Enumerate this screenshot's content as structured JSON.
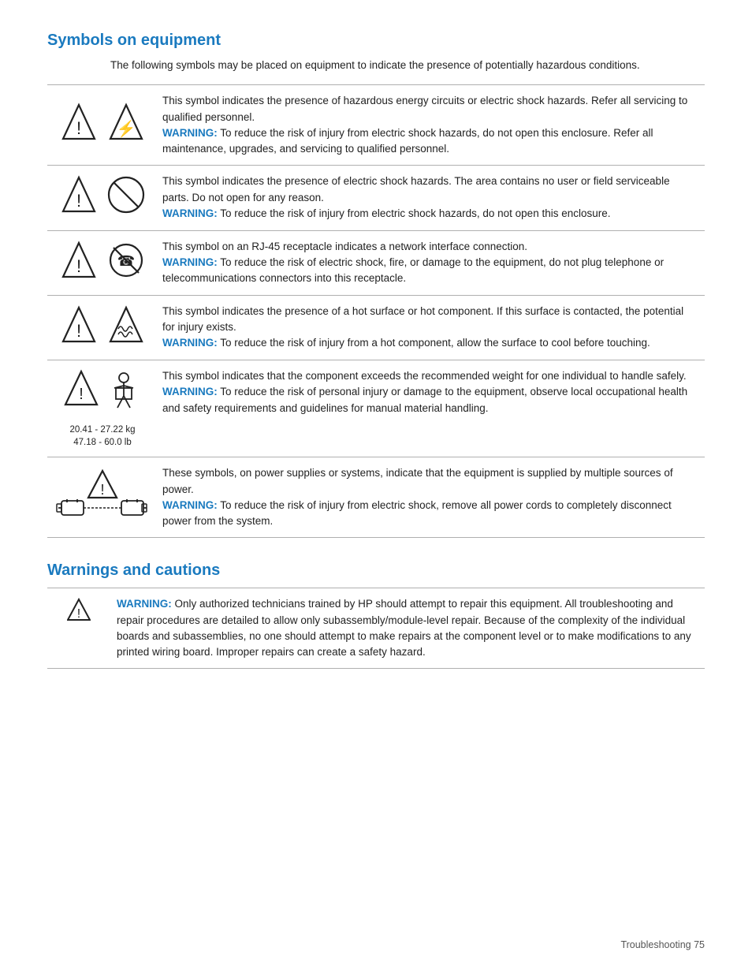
{
  "page": {
    "title": "Symbols on equipment",
    "title2": "Warnings and cautions",
    "intro": "The following symbols may be placed on equipment to indicate the presence of potentially hazardous conditions.",
    "footer": "Troubleshooting    75"
  },
  "symbols": [
    {
      "id": "symbol-1",
      "desc": "This symbol indicates the presence of hazardous energy circuits or electric shock hazards. Refer all servicing to qualified personnel.",
      "warning": "WARNING:",
      "warning_text": " To reduce the risk of injury from electric shock hazards, do not open this enclosure. Refer all maintenance, upgrades, and servicing to qualified personnel."
    },
    {
      "id": "symbol-2",
      "desc": "This symbol indicates the presence of electric shock hazards. The area contains no user or field serviceable parts. Do not open for any reason.",
      "warning": "WARNING:",
      "warning_text": " To reduce the risk of injury from electric shock hazards, do not open this enclosure."
    },
    {
      "id": "symbol-3",
      "desc": "This symbol on an RJ-45 receptacle indicates a network interface connection.",
      "warning": "WARNING:",
      "warning_text": " To reduce the risk of electric shock, fire, or damage to the equipment, do not plug telephone or telecommunications connectors into this receptacle."
    },
    {
      "id": "symbol-4",
      "desc": "This symbol indicates the presence of a hot surface or hot component. If this surface is contacted, the potential for injury exists.",
      "warning": "WARNING:",
      "warning_text": " To reduce the risk of injury from a hot component, allow the surface to cool before touching."
    },
    {
      "id": "symbol-5",
      "weight_line1": "20.41 - 27.22 kg",
      "weight_line2": "47.18 - 60.0 lb",
      "desc": "This symbol indicates that the component exceeds the recommended weight for one individual to handle safely.",
      "warning": "WARNING:",
      "warning_text": " To reduce the risk of personal injury or damage to the equipment, observe local occupational health and safety requirements and guidelines for manual material handling."
    },
    {
      "id": "symbol-6",
      "desc": "These symbols, on power supplies or systems, indicate that the equipment is supplied by multiple sources of power.",
      "warning": "WARNING:",
      "warning_text": " To reduce the risk of injury from electric shock, remove all power cords to completely disconnect power from the system."
    }
  ],
  "warnings": [
    {
      "id": "warn-1",
      "warning": "WARNING:",
      "text": "  Only authorized technicians trained by HP should attempt to repair this equipment. All troubleshooting and repair procedures are detailed to allow only subassembly/module-level repair. Because of the complexity of the individual boards and subassemblies, no one should attempt to make repairs at the component level or to make modifications to any printed wiring board. Improper repairs can create a safety hazard."
    }
  ]
}
